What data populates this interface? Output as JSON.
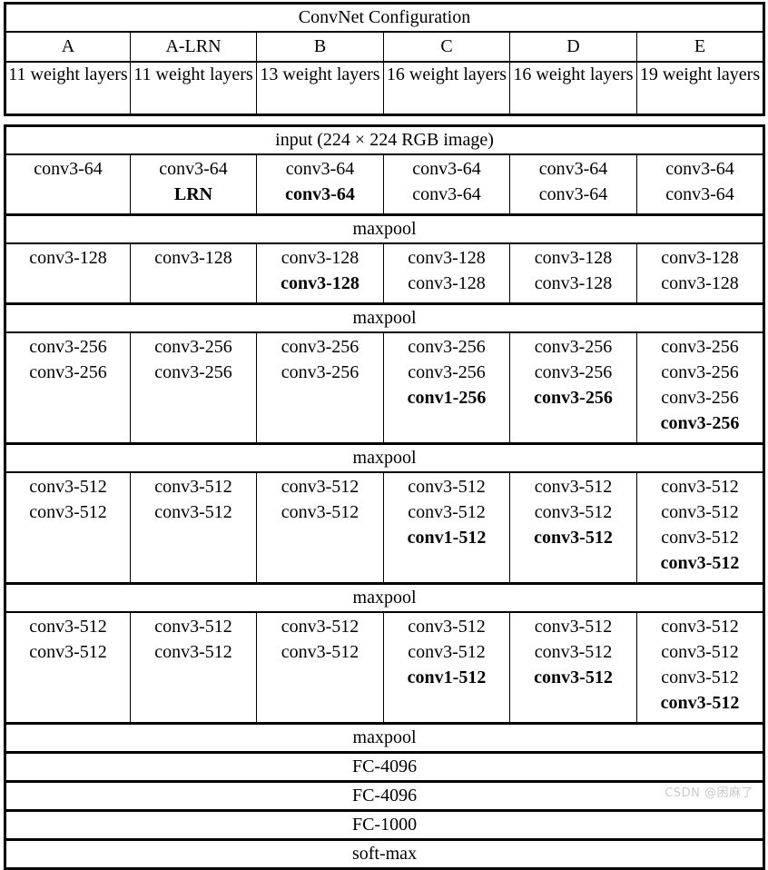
{
  "table": {
    "title": "ConvNet Configuration",
    "columns": [
      {
        "name": "A",
        "weights": "11 weight layers"
      },
      {
        "name": "A-LRN",
        "weights": "11 weight layers"
      },
      {
        "name": "B",
        "weights": "13 weight layers"
      },
      {
        "name": "C",
        "weights": "16 weight layers"
      },
      {
        "name": "D",
        "weights": "16 weight layers"
      },
      {
        "name": "E",
        "weights": "19 weight layers"
      }
    ],
    "input_row": "input (224 × 224 RGB image)",
    "maxpool_label": "maxpool",
    "blocks": [
      {
        "id": "block-64",
        "cells": [
          [
            {
              "t": "conv3-64",
              "bold": false
            }
          ],
          [
            {
              "t": "conv3-64",
              "bold": false
            },
            {
              "t": "LRN",
              "bold": true
            }
          ],
          [
            {
              "t": "conv3-64",
              "bold": false
            },
            {
              "t": "conv3-64",
              "bold": true
            }
          ],
          [
            {
              "t": "conv3-64",
              "bold": false
            },
            {
              "t": "conv3-64",
              "bold": false
            }
          ],
          [
            {
              "t": "conv3-64",
              "bold": false
            },
            {
              "t": "conv3-64",
              "bold": false
            }
          ],
          [
            {
              "t": "conv3-64",
              "bold": false
            },
            {
              "t": "conv3-64",
              "bold": false
            }
          ]
        ]
      },
      {
        "id": "block-128",
        "cells": [
          [
            {
              "t": "conv3-128",
              "bold": false
            }
          ],
          [
            {
              "t": "conv3-128",
              "bold": false
            }
          ],
          [
            {
              "t": "conv3-128",
              "bold": false
            },
            {
              "t": "conv3-128",
              "bold": true
            }
          ],
          [
            {
              "t": "conv3-128",
              "bold": false
            },
            {
              "t": "conv3-128",
              "bold": false
            }
          ],
          [
            {
              "t": "conv3-128",
              "bold": false
            },
            {
              "t": "conv3-128",
              "bold": false
            }
          ],
          [
            {
              "t": "conv3-128",
              "bold": false
            },
            {
              "t": "conv3-128",
              "bold": false
            }
          ]
        ]
      },
      {
        "id": "block-256",
        "cells": [
          [
            {
              "t": "conv3-256",
              "bold": false
            },
            {
              "t": "conv3-256",
              "bold": false
            }
          ],
          [
            {
              "t": "conv3-256",
              "bold": false
            },
            {
              "t": "conv3-256",
              "bold": false
            }
          ],
          [
            {
              "t": "conv3-256",
              "bold": false
            },
            {
              "t": "conv3-256",
              "bold": false
            }
          ],
          [
            {
              "t": "conv3-256",
              "bold": false
            },
            {
              "t": "conv3-256",
              "bold": false
            },
            {
              "t": "conv1-256",
              "bold": true
            }
          ],
          [
            {
              "t": "conv3-256",
              "bold": false
            },
            {
              "t": "conv3-256",
              "bold": false
            },
            {
              "t": "conv3-256",
              "bold": true
            }
          ],
          [
            {
              "t": "conv3-256",
              "bold": false
            },
            {
              "t": "conv3-256",
              "bold": false
            },
            {
              "t": "conv3-256",
              "bold": false
            },
            {
              "t": "conv3-256",
              "bold": true
            }
          ]
        ]
      },
      {
        "id": "block-512-a",
        "cells": [
          [
            {
              "t": "conv3-512",
              "bold": false
            },
            {
              "t": "conv3-512",
              "bold": false
            }
          ],
          [
            {
              "t": "conv3-512",
              "bold": false
            },
            {
              "t": "conv3-512",
              "bold": false
            }
          ],
          [
            {
              "t": "conv3-512",
              "bold": false
            },
            {
              "t": "conv3-512",
              "bold": false
            }
          ],
          [
            {
              "t": "conv3-512",
              "bold": false
            },
            {
              "t": "conv3-512",
              "bold": false
            },
            {
              "t": "conv1-512",
              "bold": true
            }
          ],
          [
            {
              "t": "conv3-512",
              "bold": false
            },
            {
              "t": "conv3-512",
              "bold": false
            },
            {
              "t": "conv3-512",
              "bold": true
            }
          ],
          [
            {
              "t": "conv3-512",
              "bold": false
            },
            {
              "t": "conv3-512",
              "bold": false
            },
            {
              "t": "conv3-512",
              "bold": false
            },
            {
              "t": "conv3-512",
              "bold": true
            }
          ]
        ]
      },
      {
        "id": "block-512-b",
        "cells": [
          [
            {
              "t": "conv3-512",
              "bold": false
            },
            {
              "t": "conv3-512",
              "bold": false
            }
          ],
          [
            {
              "t": "conv3-512",
              "bold": false
            },
            {
              "t": "conv3-512",
              "bold": false
            }
          ],
          [
            {
              "t": "conv3-512",
              "bold": false
            },
            {
              "t": "conv3-512",
              "bold": false
            }
          ],
          [
            {
              "t": "conv3-512",
              "bold": false
            },
            {
              "t": "conv3-512",
              "bold": false
            },
            {
              "t": "conv1-512",
              "bold": true
            }
          ],
          [
            {
              "t": "conv3-512",
              "bold": false
            },
            {
              "t": "conv3-512",
              "bold": false
            },
            {
              "t": "conv3-512",
              "bold": true
            }
          ],
          [
            {
              "t": "conv3-512",
              "bold": false
            },
            {
              "t": "conv3-512",
              "bold": false
            },
            {
              "t": "conv3-512",
              "bold": false
            },
            {
              "t": "conv3-512",
              "bold": true
            }
          ]
        ]
      }
    ],
    "classifier_rows": [
      "FC-4096",
      "FC-4096",
      "FC-1000",
      "soft-max"
    ]
  },
  "watermark": {
    "text": "CSDN @困麻了"
  }
}
